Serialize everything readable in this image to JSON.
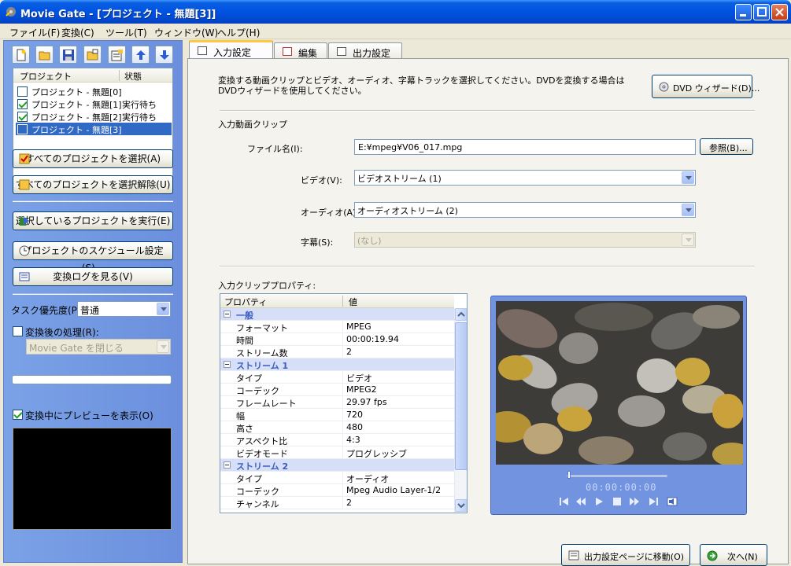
{
  "title": "Movie Gate - [プロジェクト - 無題[3]]",
  "menu": [
    "ファイル(F)",
    "変換(C)",
    "ツール(T)",
    "ウィンドウ(W)",
    "ヘルプ(H)"
  ],
  "left": {
    "list_headers": {
      "project": "プロジェクト",
      "status": "状態"
    },
    "projects": [
      {
        "name": "プロジェクト - 無題[0]",
        "status": "",
        "checked": false,
        "selected": false
      },
      {
        "name": "プロジェクト - 無題[1]",
        "status": "実行待ち",
        "checked": true,
        "selected": false
      },
      {
        "name": "プロジェクト - 無題[2]",
        "status": "実行待ち",
        "checked": true,
        "selected": false
      },
      {
        "name": "プロジェクト - 無題[3]",
        "status": "",
        "checked": false,
        "selected": true
      }
    ],
    "select_all": "すべてのプロジェクトを選択(A)",
    "deselect_all": "すべてのプロジェクトを選択解除(U)",
    "run_selected": "選択しているプロジェクトを実行(E)",
    "schedule": "プロジェクトのスケジュール設定(S)...",
    "view_log": "変換ログを見る(V)",
    "task_priority_label": "タスク優先度(P):",
    "task_priority_value": "普通",
    "after_process_label": "変換後の処理(R):",
    "after_process_value": "Movie Gate を閉じる",
    "preview_label": "変換中にプレビューを表示(O)"
  },
  "tabs": [
    {
      "label": "入力設定",
      "active": true
    },
    {
      "label": "編集",
      "active": false
    },
    {
      "label": "出力設定",
      "active": false
    }
  ],
  "input": {
    "description": "変換する動画クリップとビデオ、オーディオ、字幕トラックを選択してください。DVDを変換する場合はDVDウィザードを使用してください。",
    "dvd_wizard": "DVD ウィザード(D)...",
    "clip_section": "入力動画クリップ",
    "filename_label": "ファイル名(I):",
    "filename_value": "E:¥mpeg¥V06_017.mpg",
    "browse": "参照(B)...",
    "video_label": "ビデオ(V):",
    "video_value": "ビデオストリーム (1)",
    "audio_label": "オーディオ(A):",
    "audio_value": "オーディオストリーム (2)",
    "subtitle_label": "字幕(S):",
    "subtitle_value": "(なし)",
    "props_section": "入力クリッププロパティ:",
    "props_headers": {
      "property": "プロパティ",
      "value": "値"
    },
    "props": [
      {
        "group": "一般"
      },
      {
        "k": "フォーマット",
        "v": "MPEG"
      },
      {
        "k": "時間",
        "v": "00:00:19.94"
      },
      {
        "k": "ストリーム数",
        "v": "2"
      },
      {
        "group": "ストリーム 1"
      },
      {
        "k": "タイプ",
        "v": "ビデオ"
      },
      {
        "k": "コーデック",
        "v": "MPEG2"
      },
      {
        "k": "フレームレート",
        "v": "29.97 fps"
      },
      {
        "k": "幅",
        "v": "720"
      },
      {
        "k": "高さ",
        "v": "480"
      },
      {
        "k": "アスペクト比",
        "v": "4:3"
      },
      {
        "k": "ビデオモード",
        "v": "プログレッシブ"
      },
      {
        "group": "ストリーム 2"
      },
      {
        "k": "タイプ",
        "v": "オーディオ"
      },
      {
        "k": "コーデック",
        "v": "Mpeg Audio Layer-1/2"
      },
      {
        "k": "チャンネル",
        "v": "2"
      }
    ],
    "timecode": "00:00:00:00",
    "goto_output": "出力設定ページに移動(O)",
    "next": "次へ(N)"
  },
  "colors": {
    "title_bar": "#0054e3",
    "left_pane": "#7ba2e7",
    "selection": "#316ac5",
    "group_row": "#d6dff7"
  }
}
